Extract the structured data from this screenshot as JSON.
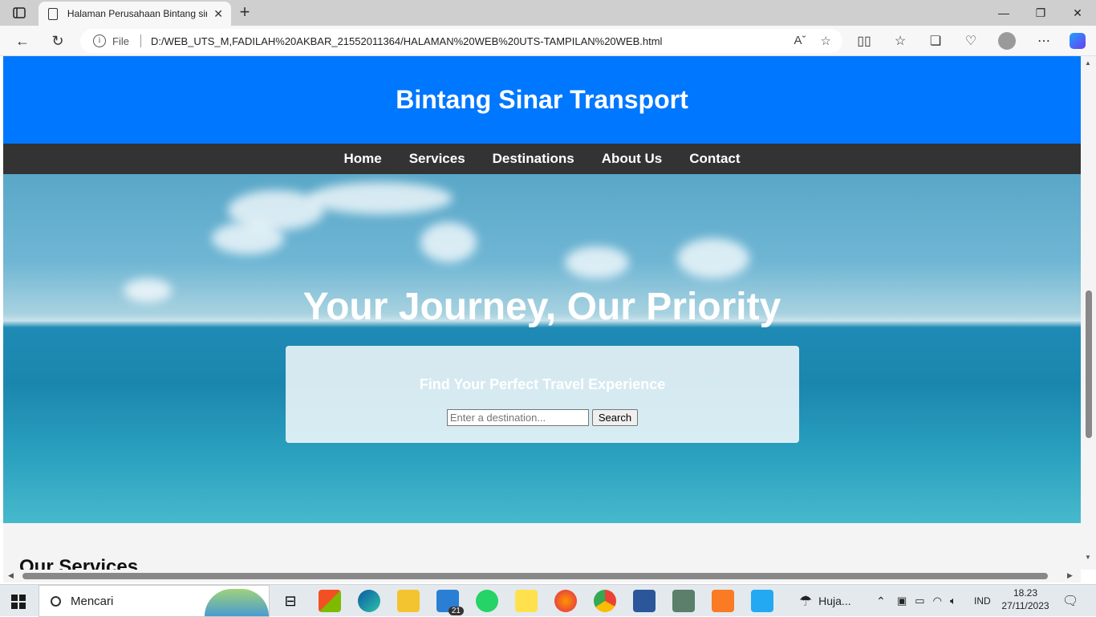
{
  "browser": {
    "tab_title": "Halaman Perusahaan Bintang sinar transport",
    "url_scheme_label": "File",
    "url": "D:/WEB_UTS_M,FADILAH%20AKBAR_21552011364/HALAMAN%20WEB%20UTS-TAMPILAN%20WEB.html"
  },
  "site": {
    "title": "Bintang Sinar Transport",
    "nav": [
      "Home",
      "Services",
      "Destinations",
      "About Us",
      "Contact"
    ],
    "hero_title": "Your Journey, Our Priority",
    "search_heading": "Find Your Perfect Travel Experience",
    "search_placeholder": "Enter a destination...",
    "search_button": "Search",
    "section_title": "Our Services"
  },
  "taskbar": {
    "search_label": "Mencari",
    "mail_badge": "21",
    "weather_label": "Huja...",
    "language": "IND",
    "time": "18.23",
    "date": "27/11/2023"
  },
  "colors": {
    "header_blue": "#0077ff",
    "nav_dark": "#333333"
  }
}
